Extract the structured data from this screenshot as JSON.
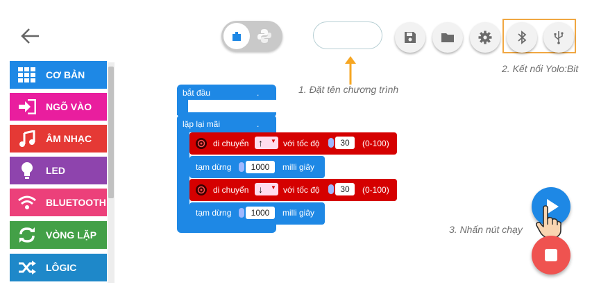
{
  "categories": [
    {
      "label": "CƠ BẢN",
      "color": "#1e88e5",
      "icon": "grid-icon"
    },
    {
      "label": "NGÕ VÀO",
      "color": "#e91e9e",
      "icon": "input-icon"
    },
    {
      "label": "ÂM NHẠC",
      "color": "#e53935",
      "icon": "music-icon"
    },
    {
      "label": "LED",
      "color": "#8e44ad",
      "icon": "bulb-icon"
    },
    {
      "label": "BLUETOOTH",
      "color": "#ec407a",
      "icon": "wifi-icon"
    },
    {
      "label": "VÒNG LẶP",
      "color": "#43a047",
      "icon": "loop-icon"
    },
    {
      "label": "LÔGIC",
      "color": "#1e88c9",
      "icon": "shuffle-icon"
    }
  ],
  "annotations": {
    "step1": "1. Đặt tên chương trình",
    "step2": "2. Kết nối Yolo:Bit",
    "step3": "3. Nhấn nút chạy"
  },
  "program_name": {
    "value": "",
    "placeholder": ""
  },
  "toolbar": {
    "buttons": [
      "save-icon",
      "folder-icon",
      "gear-icon",
      "bluetooth-icon",
      "usb-icon"
    ],
    "mode": "blocks"
  },
  "blocks": {
    "start_label": "bắt đầu",
    "start_dot": ".",
    "loop_label": "lặp lại mãi",
    "loop_dot": ".",
    "move1": {
      "label": "di chuyển",
      "direction": "↑",
      "speed_label": "với tốc độ",
      "speed": "30",
      "range": "(0-100)"
    },
    "pause1": {
      "label": "tạm dừng",
      "value": "1000",
      "unit": "milli giây"
    },
    "move2": {
      "label": "di chuyển",
      "direction": "↓",
      "speed_label": "với tốc độ",
      "speed": "30",
      "range": "(0-100)"
    },
    "pause2": {
      "label": "tạm dừng",
      "value": "1000",
      "unit": "milli giây"
    }
  },
  "colors": {
    "basic_block": "#1e88e5",
    "motor_block": "#d50000",
    "highlight": "#f0a742"
  }
}
